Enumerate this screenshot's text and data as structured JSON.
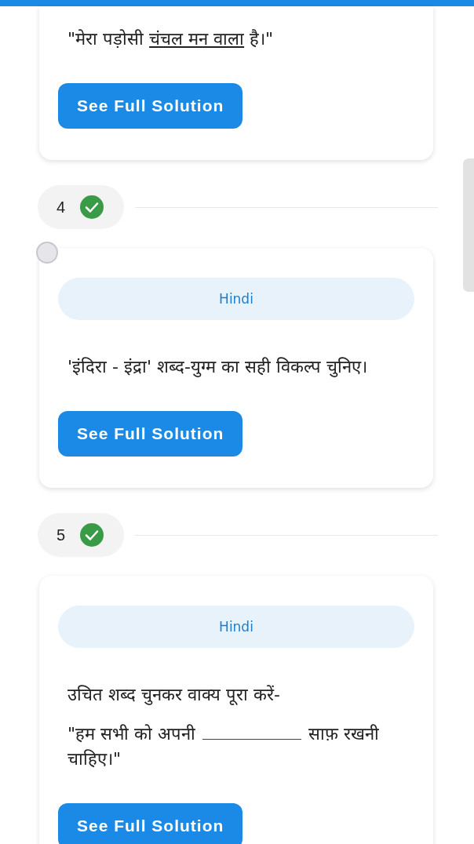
{
  "questions": [
    {
      "cut_top": true,
      "paragraphs": [
        [
          {
            "kind": "text",
            "text": "\"मेरा पड़ोसी "
          },
          {
            "kind": "underline",
            "text": "चंचल मन वाला"
          },
          {
            "kind": "text",
            "text": " है।\""
          }
        ]
      ],
      "button": "See Full Solution"
    },
    {
      "number": "4",
      "answered": true,
      "radio": {
        "selected": false
      },
      "subject": "Hindi",
      "paragraphs": [
        [
          {
            "kind": "text",
            "text": "'इंदिरा - इंद्रा' शब्द-युग्म का सही विकल्प चुनिए।"
          }
        ]
      ],
      "button": "See Full Solution"
    },
    {
      "number": "5",
      "answered": true,
      "subject": "Hindi",
      "paragraphs": [
        [
          {
            "kind": "text",
            "text": "उचित शब्द चुनकर वाक्य पूरा करें-"
          }
        ],
        [
          {
            "kind": "text",
            "text": "\"हम सभी को अपनी "
          },
          {
            "kind": "blank"
          },
          {
            "kind": "text",
            "text": " साफ़ रखनी चाहिए।\""
          }
        ]
      ],
      "button": "See Full Solution"
    }
  ]
}
